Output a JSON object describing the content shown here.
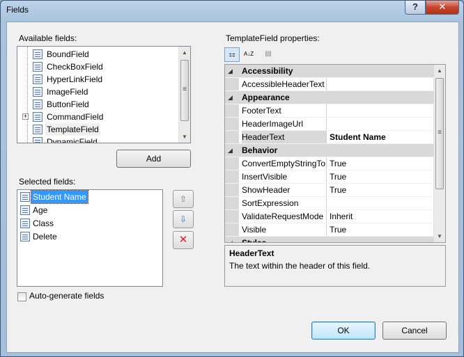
{
  "window": {
    "title": "Fields",
    "help_label": "?",
    "close_label": "✕"
  },
  "available": {
    "label": "Available fields:",
    "items": [
      {
        "label": "BoundField",
        "icon": "boundfield-icon"
      },
      {
        "label": "CheckBoxField",
        "icon": "checkboxfield-icon"
      },
      {
        "label": "HyperLinkField",
        "icon": "hyperlinkfield-icon"
      },
      {
        "label": "ImageField",
        "icon": "imagefield-icon"
      },
      {
        "label": "ButtonField",
        "icon": "buttonfield-icon"
      },
      {
        "label": "CommandField",
        "icon": "commandfield-icon"
      },
      {
        "label": "TemplateField",
        "icon": "templatefield-icon"
      },
      {
        "label": "DynamicField",
        "icon": "dynamicfield-icon"
      }
    ],
    "expander": "+",
    "add_label": "Add"
  },
  "selected": {
    "label": "Selected fields:",
    "items": [
      {
        "label": "Student Name",
        "selected": true
      },
      {
        "label": "Age"
      },
      {
        "label": "Class"
      },
      {
        "label": "Delete"
      }
    ]
  },
  "autogen": {
    "label": "Auto-generate fields",
    "checked": false
  },
  "props": {
    "label": "TemplateField properties:",
    "toolbar": {
      "categorized": "⚏",
      "alphabetical": "A↓Z",
      "pages": "▤"
    },
    "rows": [
      {
        "type": "cat",
        "name": "Accessibility"
      },
      {
        "type": "prop",
        "name": "AccessibleHeaderText",
        "value": ""
      },
      {
        "type": "cat",
        "name": "Appearance"
      },
      {
        "type": "prop",
        "name": "FooterText",
        "value": ""
      },
      {
        "type": "prop",
        "name": "HeaderImageUrl",
        "value": ""
      },
      {
        "type": "prop",
        "name": "HeaderText",
        "value": "Student Name",
        "bold": true,
        "selected": true
      },
      {
        "type": "cat",
        "name": "Behavior"
      },
      {
        "type": "prop",
        "name": "ConvertEmptyStringTo",
        "value": "True"
      },
      {
        "type": "prop",
        "name": "InsertVisible",
        "value": "True"
      },
      {
        "type": "prop",
        "name": "ShowHeader",
        "value": "True"
      },
      {
        "type": "prop",
        "name": "SortExpression",
        "value": ""
      },
      {
        "type": "prop",
        "name": "ValidateRequestMode",
        "value": "Inherit"
      },
      {
        "type": "prop",
        "name": "Visible",
        "value": "True"
      },
      {
        "type": "cat",
        "name": "Styles"
      }
    ],
    "desc_title": "HeaderText",
    "desc_text": "The text within the header of this field."
  },
  "buttons": {
    "ok": "OK",
    "cancel": "Cancel",
    "move_up": "⇧",
    "move_down": "⇩",
    "delete": "✕"
  },
  "colors": {
    "selection": "#3399ff",
    "delete_red": "#e02020",
    "arrow_blue": "#2a6fd6"
  }
}
